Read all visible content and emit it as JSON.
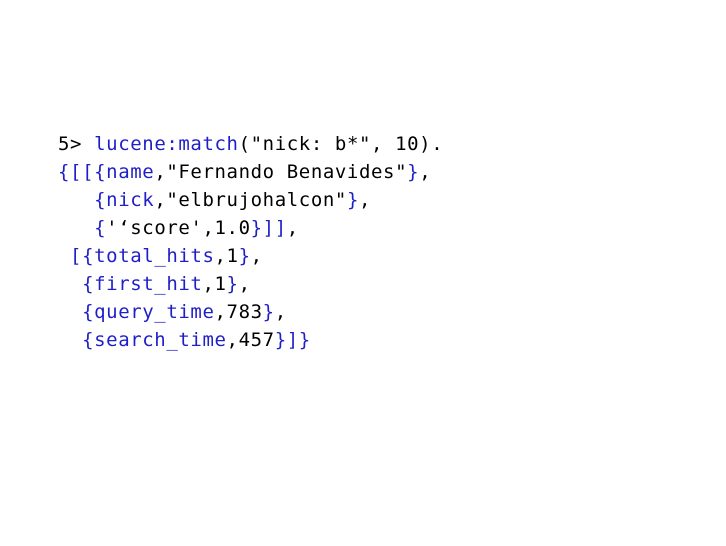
{
  "colors": {
    "code_blue": "#1f1fc8",
    "code_black": "#000000",
    "background": "#ffffff"
  },
  "lines": [
    [
      {
        "text": "5> ",
        "color": "black"
      },
      {
        "text": "lucene:match",
        "color": "blue"
      },
      {
        "text": "(\"nick: b*\", 10).",
        "color": "black"
      }
    ],
    [
      {
        "text": "{[[{",
        "color": "blue"
      },
      {
        "text": "name",
        "color": "blue"
      },
      {
        "text": ",\"Fernando Benavides\"",
        "color": "black"
      },
      {
        "text": "}",
        "color": "blue"
      },
      {
        "text": ",",
        "color": "black"
      }
    ],
    [
      {
        "text": "   ",
        "color": "black"
      },
      {
        "text": "{nick",
        "color": "blue"
      },
      {
        "text": ",\"elbrujohalcon\"",
        "color": "black"
      },
      {
        "text": "}",
        "color": "blue"
      },
      {
        "text": ",",
        "color": "black"
      }
    ],
    [
      {
        "text": "   ",
        "color": "black"
      },
      {
        "text": "{",
        "color": "blue"
      },
      {
        "text": "'‘score',1.0",
        "color": "black"
      },
      {
        "text": "}]]",
        "color": "blue"
      },
      {
        "text": ",",
        "color": "black"
      }
    ],
    [
      {
        "text": " ",
        "color": "black"
      },
      {
        "text": "[{total_hits",
        "color": "blue"
      },
      {
        "text": ",1",
        "color": "black"
      },
      {
        "text": "}",
        "color": "blue"
      },
      {
        "text": ",",
        "color": "black"
      }
    ],
    [
      {
        "text": "  ",
        "color": "black"
      },
      {
        "text": "{first_hit",
        "color": "blue"
      },
      {
        "text": ",1",
        "color": "black"
      },
      {
        "text": "}",
        "color": "blue"
      },
      {
        "text": ",",
        "color": "black"
      }
    ],
    [
      {
        "text": "  ",
        "color": "black"
      },
      {
        "text": "{query_time",
        "color": "blue"
      },
      {
        "text": ",783",
        "color": "black"
      },
      {
        "text": "}",
        "color": "blue"
      },
      {
        "text": ",",
        "color": "black"
      }
    ],
    [
      {
        "text": "  ",
        "color": "black"
      },
      {
        "text": "{search_time",
        "color": "blue"
      },
      {
        "text": ",457",
        "color": "black"
      },
      {
        "text": "}]}",
        "color": "blue"
      }
    ]
  ]
}
